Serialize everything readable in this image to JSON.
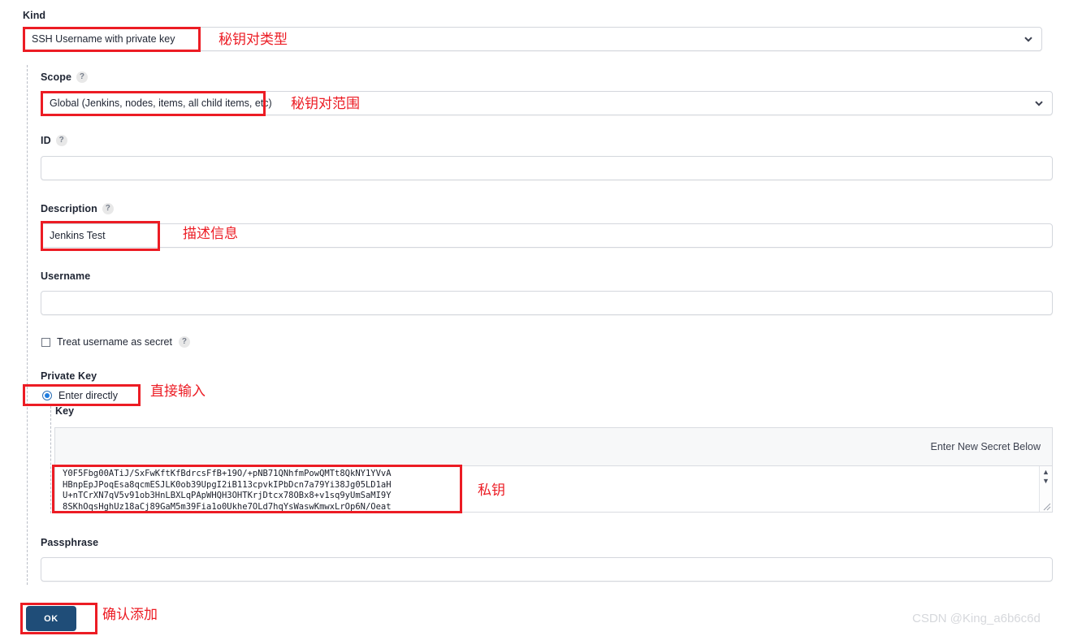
{
  "form": {
    "kind": {
      "label": "Kind",
      "value": "SSH Username with private key",
      "chevron_icon": "chevron-down-icon"
    },
    "scope": {
      "label": "Scope",
      "help": "?",
      "value": "Global (Jenkins, nodes, items, all child items, etc)",
      "chevron_icon": "chevron-down-icon"
    },
    "id": {
      "label": "ID",
      "help": "?",
      "value": ""
    },
    "description": {
      "label": "Description",
      "help": "?",
      "value": "Jenkins Test"
    },
    "username": {
      "label": "Username",
      "value": ""
    },
    "treat_username_as_secret": {
      "label": "Treat username as secret",
      "help": "?",
      "checked": false
    },
    "private_key": {
      "label": "Private Key",
      "option_enter_directly": "Enter directly",
      "selected": true,
      "key_label": "Key",
      "secret_hint": "Enter New Secret Below",
      "key_lines": [
        "Y0F5Fbg00ATiJ/SxFwKftKfBdrcsFfB+19O/+pNB71QNhfmPowQMTt8QkNY1YVvA",
        "HBnpEpJPoqEsa8qcmESJLK0ob39UpgI2iB113cpvkIPbDcn7a79Yi38Jg05LD1aH",
        "U+nTCrXN7qV5v91ob3HnLBXLqPApWHQH3OHTKrjDtcx78OBx8+v1sq9yUmSaMI9Y",
        "8SKhOqsHghUz18aCj89GaM5m39Fia1o0Ukhe7OLd7hqYsWaswKmwxLrOp6N/Oeat"
      ],
      "scroll_up_icon": "triangle-up-icon",
      "scroll_down_icon": "triangle-down-icon",
      "resize_icon": "resize-grip-icon"
    },
    "passphrase": {
      "label": "Passphrase",
      "value": ""
    },
    "ok_button": "OK"
  },
  "annotations": {
    "kind": "秘钥对类型",
    "scope": "秘钥对范围",
    "description": "描述信息",
    "enter_directly": "直接输入",
    "private_key": "私钥",
    "ok": "确认添加"
  },
  "watermark": "CSDN @King_a6b6c6d",
  "colors": {
    "annotation_red": "#ec1c24",
    "button_blue": "#1f4d78",
    "radio_blue": "#1f7de0"
  }
}
